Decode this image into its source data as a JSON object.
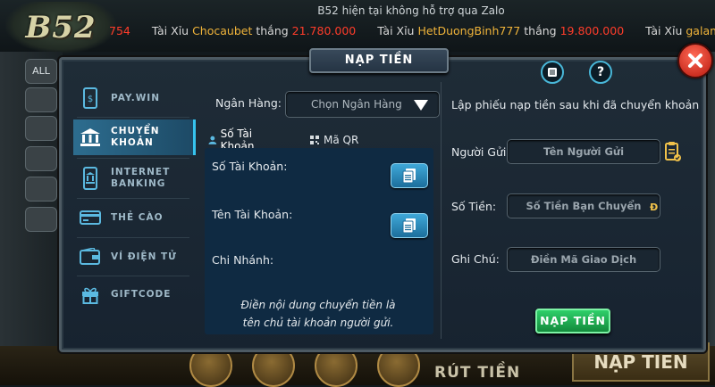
{
  "background": {
    "logo_text": "B52",
    "banner": "B52 hiện tại không hỗ trợ qua Zalo",
    "ticker": [
      {
        "prefix": "",
        "name": "",
        "verb": "",
        "amount": "754"
      },
      {
        "prefix": "Tài Xỉu",
        "name": "Chocaubet",
        "verb": "thắng",
        "amount": "21.780.000"
      },
      {
        "prefix": "Tài Xỉu",
        "name": "HetDuongBinh777",
        "verb": "thắng",
        "amount": "19.800.000"
      },
      {
        "prefix": "Tài Xỉu",
        "name": "galamb",
        "verb": "",
        "amount": ""
      }
    ],
    "left_buttons": [
      "ALL",
      "",
      "",
      "",
      "",
      ""
    ],
    "bottom_withdraw": "RÚT TIỀN",
    "bottom_deposit": "NẠP TIỀN"
  },
  "modal": {
    "title": "NẠP TIỀN",
    "icons": [
      "list-icon",
      "help-icon",
      "close-icon"
    ]
  },
  "sidebar": {
    "items": [
      {
        "label": "PAY.WIN",
        "icon": "phone-dollar-icon",
        "active": false
      },
      {
        "label": "CHUYỂN KHOẢN",
        "icon": "bank-icon",
        "active": true
      },
      {
        "label": "INTERNET BANKING",
        "icon": "mobile-banking-icon",
        "active": false
      },
      {
        "label": "THẺ CÀO",
        "icon": "card-icon",
        "active": false
      },
      {
        "label": "VÍ ĐIỆN TỬ",
        "icon": "wallet-icon",
        "active": false
      },
      {
        "label": "GIFTCODE",
        "icon": "gift-icon",
        "active": false
      }
    ]
  },
  "middle": {
    "bank_label": "Ngân Hàng:",
    "bank_select_value": "Chọn Ngân Hàng",
    "tabs": [
      {
        "label": "Số Tài Khoản",
        "active": true
      },
      {
        "label": "Mã QR",
        "active": false
      }
    ],
    "account_number_label": "Số Tài Khoản:",
    "account_name_label": "Tên Tài Khoản:",
    "branch_label": "Chi Nhánh:",
    "note_line1": "Điền nội dung chuyển tiền là",
    "note_line2": "tên chủ tài khoản người gửi."
  },
  "right": {
    "instruction": "Lập phiếu nạp tiền sau khi đã chuyển khoản",
    "sender_label": "Người Gửi:",
    "sender_placeholder": "Tên Người Gửi",
    "amount_label": "Số Tiền:",
    "amount_placeholder": "Số Tiền Bạn Chuyển",
    "currency_symbol": "Đ",
    "note_label": "Ghi Chú:",
    "note_placeholder": "Điền Mã Giao Dịch",
    "submit_label": "NẠP TIỀN"
  },
  "colors": {
    "accent": "#36c3ee",
    "submit": "#1fae53",
    "close": "#d8261a",
    "winner_name": "#f0b43a",
    "winner_amount": "#ff3c2a"
  }
}
